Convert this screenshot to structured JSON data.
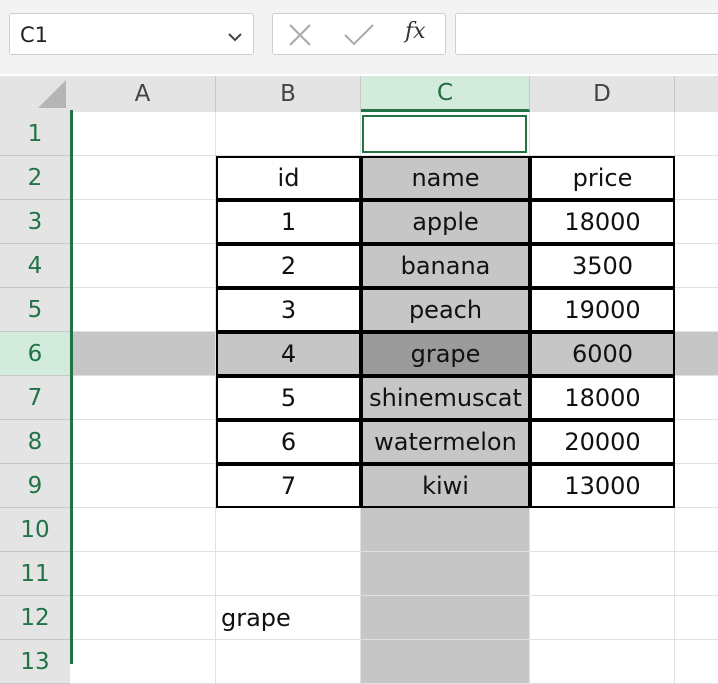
{
  "name_box": {
    "value": "C1"
  },
  "formula_bar": {
    "function_symbol": "fx",
    "value": ""
  },
  "columns": [
    "A",
    "B",
    "C",
    "D"
  ],
  "rows": [
    "1",
    "2",
    "3",
    "4",
    "5",
    "6",
    "7",
    "8",
    "9",
    "10",
    "11",
    "12",
    "13"
  ],
  "selected_column": "C",
  "selected_row": "6",
  "table": {
    "headers": [
      "id",
      "name",
      "price"
    ],
    "rows": [
      [
        "1",
        "apple",
        "18000"
      ],
      [
        "2",
        "banana",
        "3500"
      ],
      [
        "3",
        "peach",
        "19000"
      ],
      [
        "4",
        "grape",
        "6000"
      ],
      [
        "5",
        "shinemuscat",
        "18000"
      ],
      [
        "6",
        "watermelon",
        "20000"
      ],
      [
        "7",
        "kiwi",
        "13000"
      ]
    ]
  },
  "cell_b12": "grape",
  "colors": {
    "accent": "#217346",
    "shade": "#c6c6c6",
    "dark_shade": "#9b9b9b"
  }
}
